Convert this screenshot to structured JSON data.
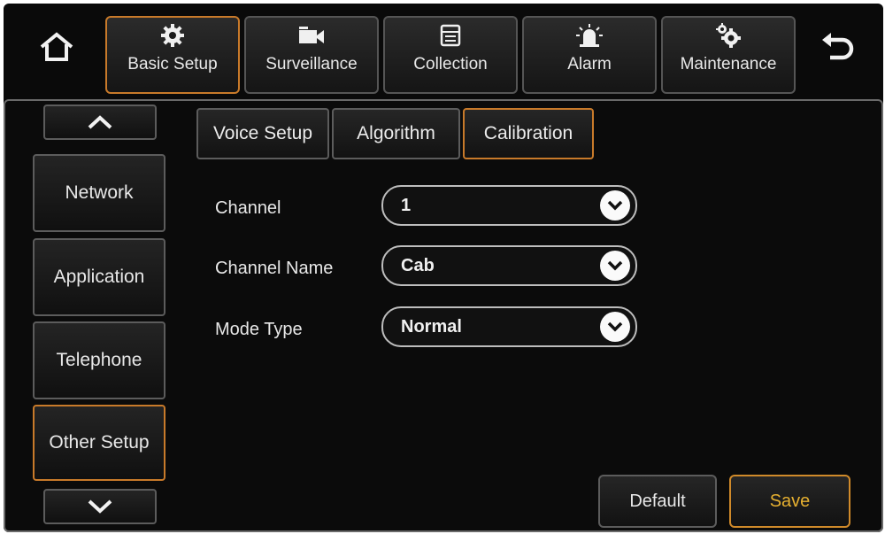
{
  "top_tabs": [
    {
      "label": "Basic Setup",
      "icon": "gear-icon"
    },
    {
      "label": "Surveillance",
      "icon": "camera-icon"
    },
    {
      "label": "Collection",
      "icon": "collection-icon"
    },
    {
      "label": "Alarm",
      "icon": "alarm-icon"
    },
    {
      "label": "Maintenance",
      "icon": "maintenance-gears-icon"
    }
  ],
  "sidebar": {
    "items": [
      {
        "label": "Network"
      },
      {
        "label": "Application"
      },
      {
        "label": "Telephone"
      },
      {
        "label": "Other Setup"
      }
    ]
  },
  "sub_tabs": [
    {
      "label": "Voice Setup"
    },
    {
      "label": "Algorithm"
    },
    {
      "label": "Calibration"
    }
  ],
  "form": {
    "channel": {
      "label": "Channel",
      "value": "1"
    },
    "channel_name": {
      "label": "Channel Name",
      "value": "Cab"
    },
    "mode_type": {
      "label": "Mode Type",
      "value": "Normal"
    }
  },
  "actions": {
    "default_label": "Default",
    "save_label": "Save"
  },
  "colors": {
    "accent": "#c87a2a",
    "save_text": "#e6b030",
    "background": "#0a0a0a"
  }
}
